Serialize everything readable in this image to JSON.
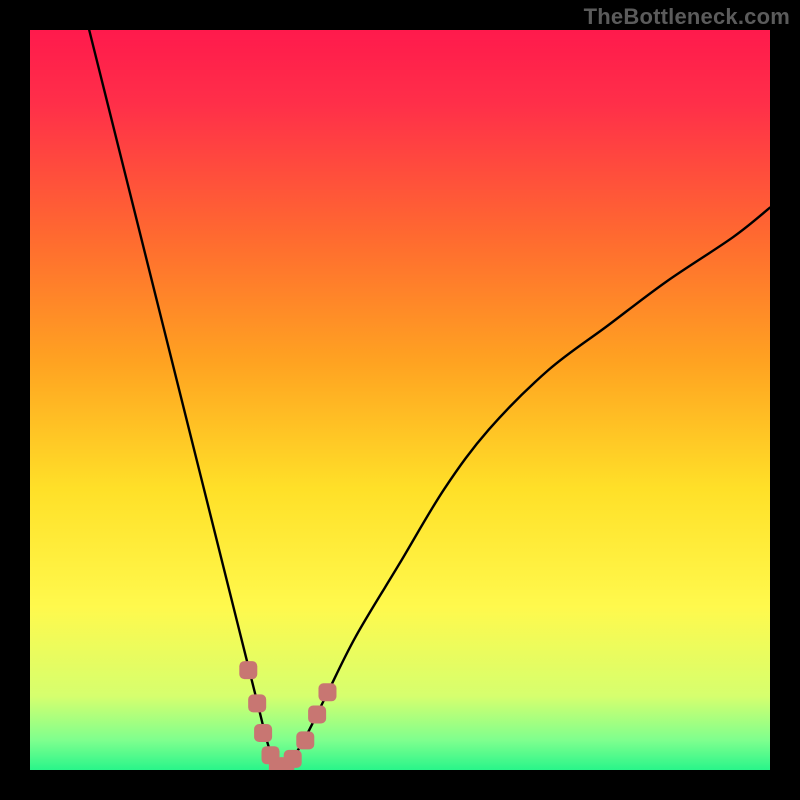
{
  "watermark": "TheBottleneck.com",
  "colors": {
    "background": "#000000",
    "gradient_stops": [
      {
        "offset": 0,
        "color": "#ff1a4c"
      },
      {
        "offset": 0.1,
        "color": "#ff2f49"
      },
      {
        "offset": 0.28,
        "color": "#ff6a30"
      },
      {
        "offset": 0.45,
        "color": "#ffa321"
      },
      {
        "offset": 0.62,
        "color": "#ffe028"
      },
      {
        "offset": 0.78,
        "color": "#fff94d"
      },
      {
        "offset": 0.9,
        "color": "#d6ff6e"
      },
      {
        "offset": 0.96,
        "color": "#7eff8e"
      },
      {
        "offset": 1.0,
        "color": "#29f58a"
      }
    ],
    "curve": "#000000",
    "markers": "#c87672"
  },
  "chart_data": {
    "type": "line",
    "title": "",
    "xlabel": "",
    "ylabel": "",
    "xlim": [
      0,
      100
    ],
    "ylim": [
      0,
      100
    ],
    "grid": false,
    "legend": false,
    "series": [
      {
        "name": "bottleneck-curve",
        "x": [
          8,
          10,
          12,
          14,
          16,
          18,
          20,
          22,
          24,
          26,
          28,
          30,
          31,
          32,
          33,
          34,
          35,
          37,
          40,
          44,
          50,
          56,
          62,
          70,
          78,
          86,
          95,
          100
        ],
        "y": [
          100,
          92,
          84,
          76,
          68,
          60,
          52,
          44,
          36,
          28,
          20,
          12,
          8,
          4,
          1,
          0,
          1,
          4,
          10,
          18,
          28,
          38,
          46,
          54,
          60,
          66,
          72,
          76
        ]
      }
    ],
    "markers": {
      "name": "highlighted-range",
      "x": [
        29.5,
        30.7,
        31.5,
        32.5,
        33.5,
        34.5,
        35.5,
        37.2,
        38.8,
        40.2
      ],
      "y": [
        13.5,
        9.0,
        5.0,
        2.0,
        0.5,
        0.5,
        1.5,
        4.0,
        7.5,
        10.5
      ]
    }
  }
}
